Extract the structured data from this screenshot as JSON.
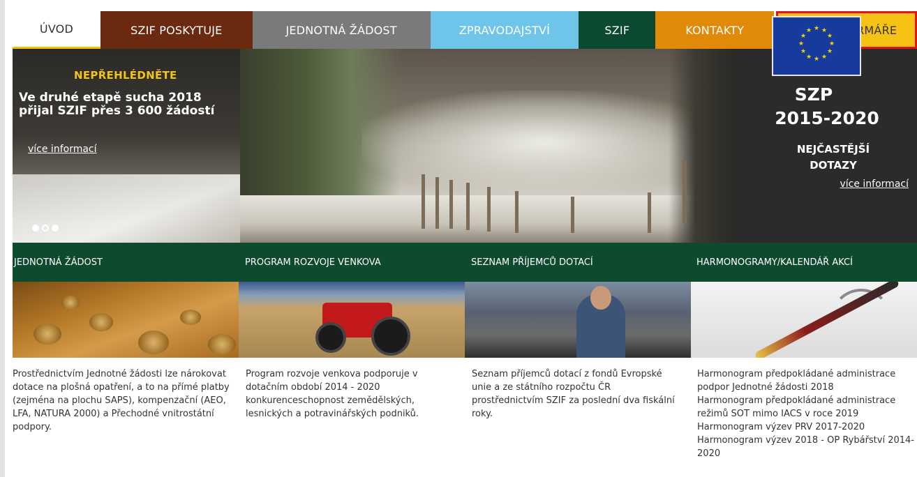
{
  "nav": {
    "home": "ÚVOD",
    "szif_poskytuje": "SZIF POSKYTUJE",
    "jednotna_zadost": "JEDNOTNÁ ŽÁDOST",
    "zpravodajstvi": "ZPRAVODAJSTVÍ",
    "szif": "SZIF",
    "kontakty": "KONTAKTY",
    "portal_farmare": "PORTÁL FARMÁŘE"
  },
  "hero": {
    "kicker": "NEPŘEHLÉDNĚTE",
    "title": "Ve druhé etapě sucha 2018 přijal SZIF přes 3 600 žádostí",
    "link": "více informací",
    "slides_count": 3,
    "active_slide": 1
  },
  "szp": {
    "title": "SZP",
    "years": "2015-2020",
    "faq_line1": "NEJČASTĚJŠÍ",
    "faq_line2": "DOTAZY",
    "link": "více informací"
  },
  "sections": [
    {
      "heading": "JEDNOTNÁ ŽÁDOST",
      "image": "hay-bales-field",
      "text": "Prostřednictvím Jednotné žádosti lze nárokovat dotace na plošná opatření, a to na přímé platby (zejména na plochu SAPS), kompenzační (AEO, LFA, NATURA 2000) a Přechodné vnitrostátní podpory."
    },
    {
      "heading": "PROGRAM ROZVOJE VENKOVA",
      "image": "red-tractor-cattle",
      "text": "Program rozvoje venkova podporuje v dotačním období 2014 - 2020 konkurenceschopnost zemědělských, lesnických a potravinářských podniků."
    },
    {
      "heading": "SEZNAM PŘÍJEMCŮ DOTACÍ",
      "image": "farmer-cows",
      "text": "Seznam příjemců dotací z fondů Evropské unie a ze státního rozpočtu ČR prostřednictvím SZIF za poslední dva fiskální roky."
    },
    {
      "heading": "HARMONOGRAMY/KALENDÁŘ AKCÍ",
      "image": "pen-notebook",
      "links": [
        "Harmonogram předpokládané administrace podpor Jednotné žádosti 2018",
        "Harmonogram předpokládané administrace režimů SOT mimo IACS v roce 2019",
        "Harmonogram výzev PRV 2017-2020",
        "Harmonogram výzev 2018 - OP Rybářství 2014-2020"
      ]
    }
  ],
  "colors": {
    "nav_szif_poskytuje": "#6b2a10",
    "nav_jednotna": "#7a7a7a",
    "nav_zprav": "#6ec5e9",
    "nav_szif": "#0b4a2e",
    "nav_kontakty": "#e18a09",
    "nav_portal": "#f6c315",
    "highlight_border": "#e0141b",
    "section_bar": "#0e4a2d",
    "kicker": "#f2c31a"
  }
}
